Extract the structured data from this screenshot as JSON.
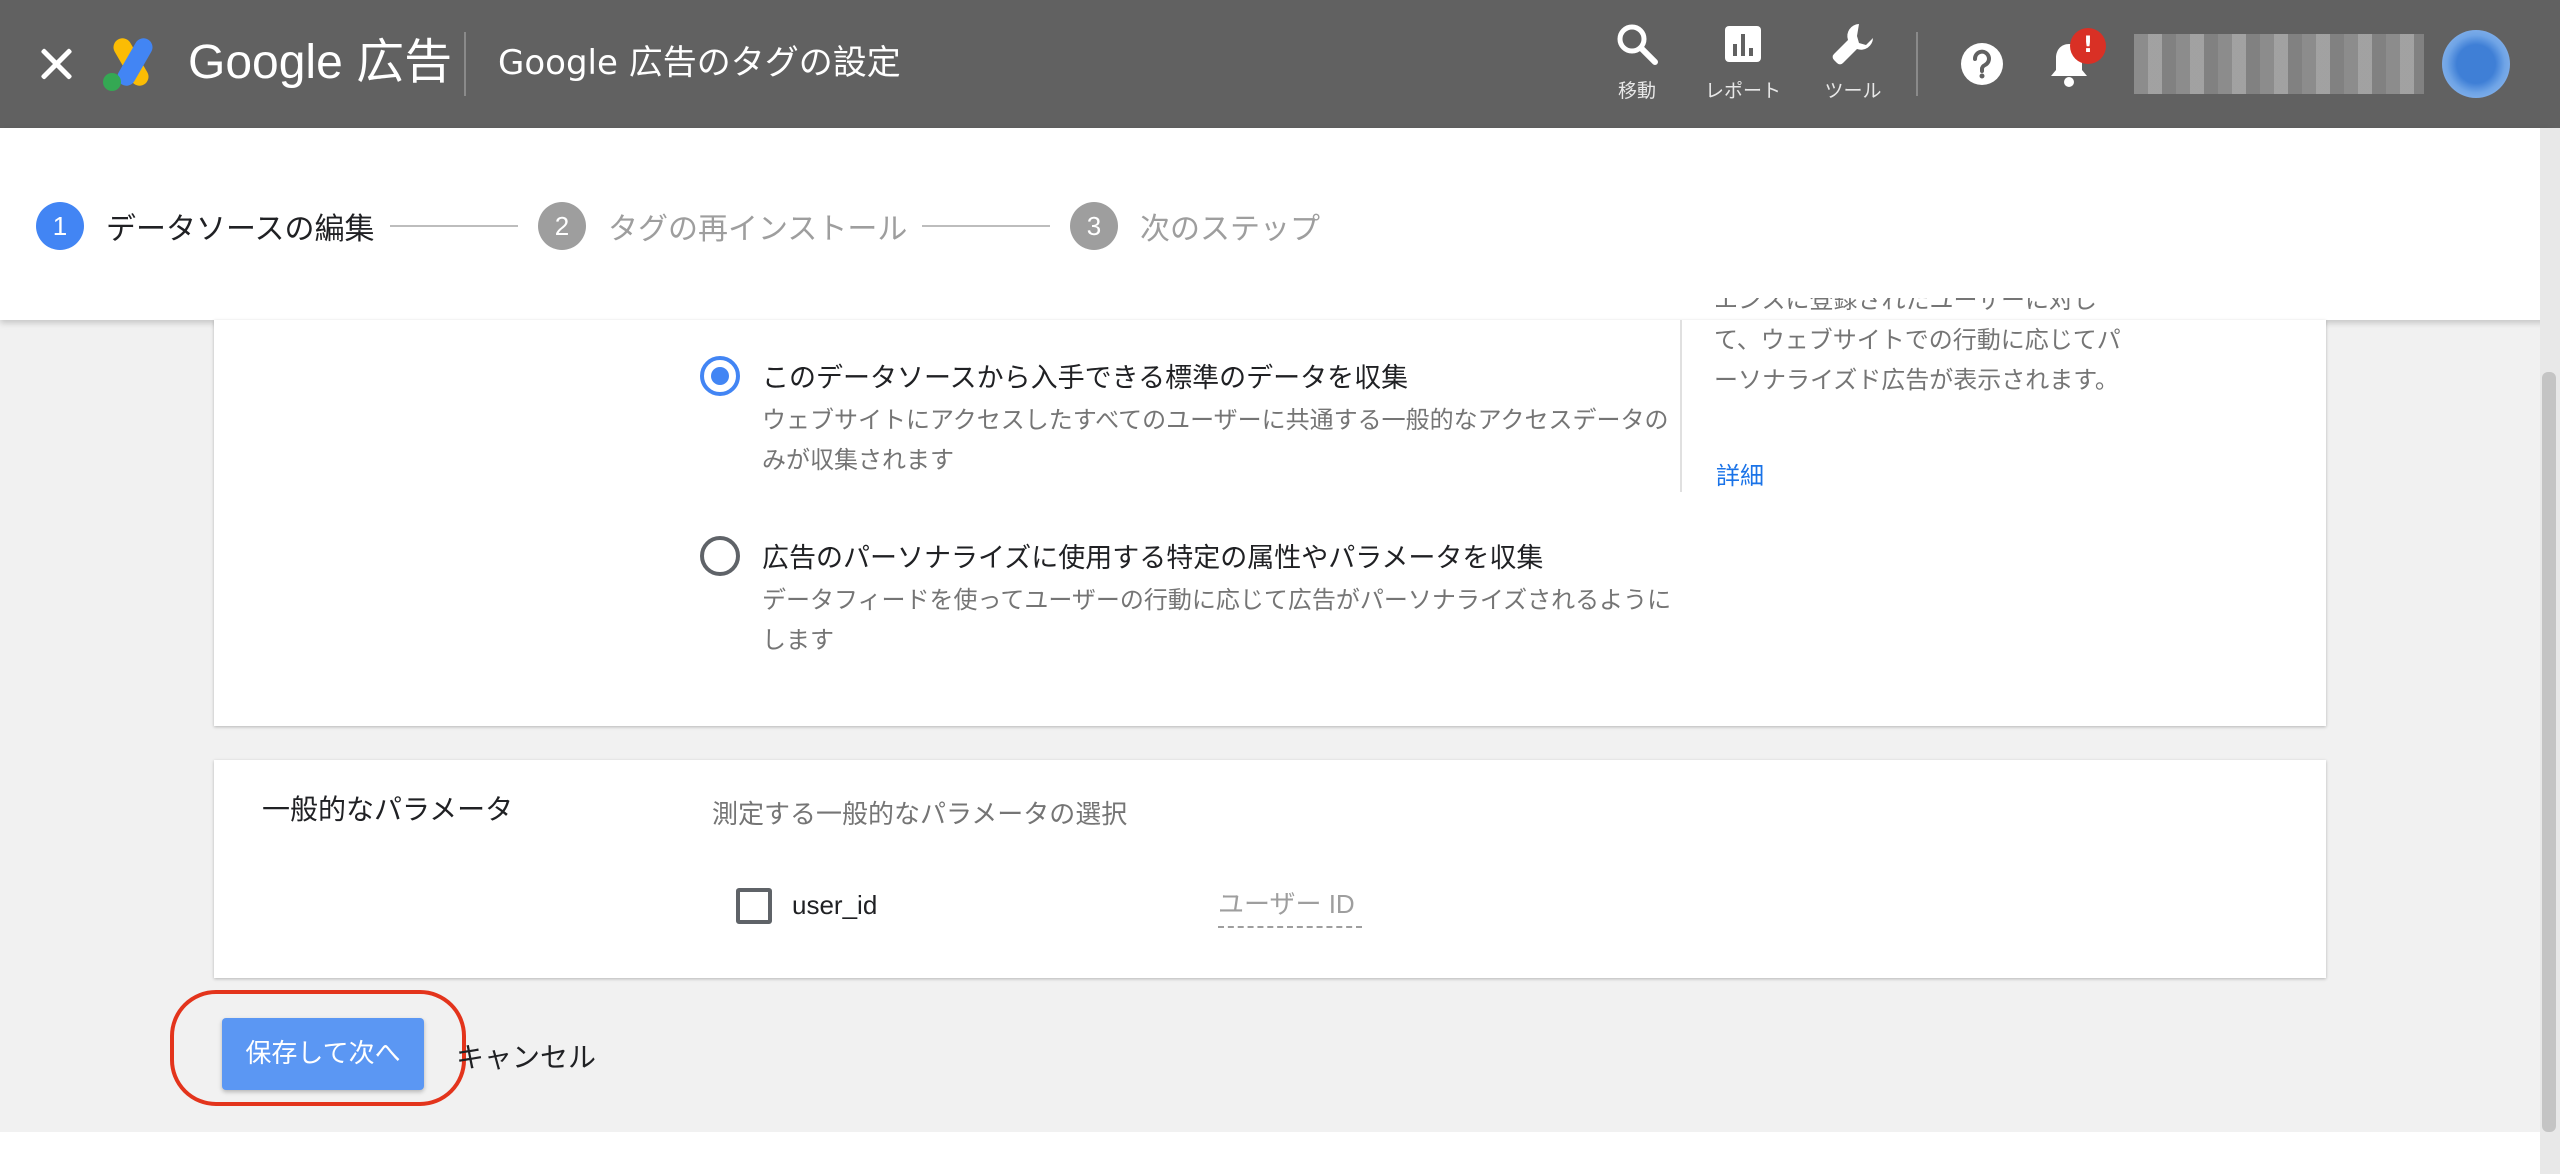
{
  "header": {
    "brand": "Google 広告",
    "page_title": "Google 広告のタグの設定",
    "nav": [
      {
        "label": "移動",
        "icon": "search-icon"
      },
      {
        "label": "レポート",
        "icon": "report-icon"
      },
      {
        "label": "ツール",
        "icon": "wrench-icon"
      }
    ],
    "notification_badge": "!"
  },
  "stepper": {
    "steps": [
      {
        "num": "1",
        "label": "データソースの編集",
        "active": true
      },
      {
        "num": "2",
        "label": "タグの再インストール",
        "active": false
      },
      {
        "num": "3",
        "label": "次のステップ",
        "active": false
      }
    ]
  },
  "data_collection": {
    "options": [
      {
        "title": "このデータソースから入手できる標準のデータを収集",
        "desc": "ウェブサイトにアクセスしたすべてのユーザーに共通する一般的なアクセスデータのみが収集されます",
        "selected": true
      },
      {
        "title": "広告のパーソナライズに使用する特定の属性やパラメータを収集",
        "desc": "データフィードを使ってユーザーの行動に応じて広告がパーソナライズされるようにします",
        "selected": false
      }
    ],
    "side_help": {
      "line0": "エンスに登録されたユーザーに対し",
      "line1": "て、ウェブサイトでの行動に応じてパ",
      "line2": "ーソナライズド広告が表示されます。",
      "link": "詳細"
    }
  },
  "general_params": {
    "title": "一般的なパラメータ",
    "subtitle": "測定する一般的なパラメータの選択",
    "param_name": "user_id",
    "param_placeholder": "ユーザー ID"
  },
  "actions": {
    "save": "保存して次へ",
    "cancel": "キャンセル"
  },
  "colors": {
    "accent": "#4285f4",
    "header_bg": "#616161",
    "highlight": "#e3341c"
  }
}
